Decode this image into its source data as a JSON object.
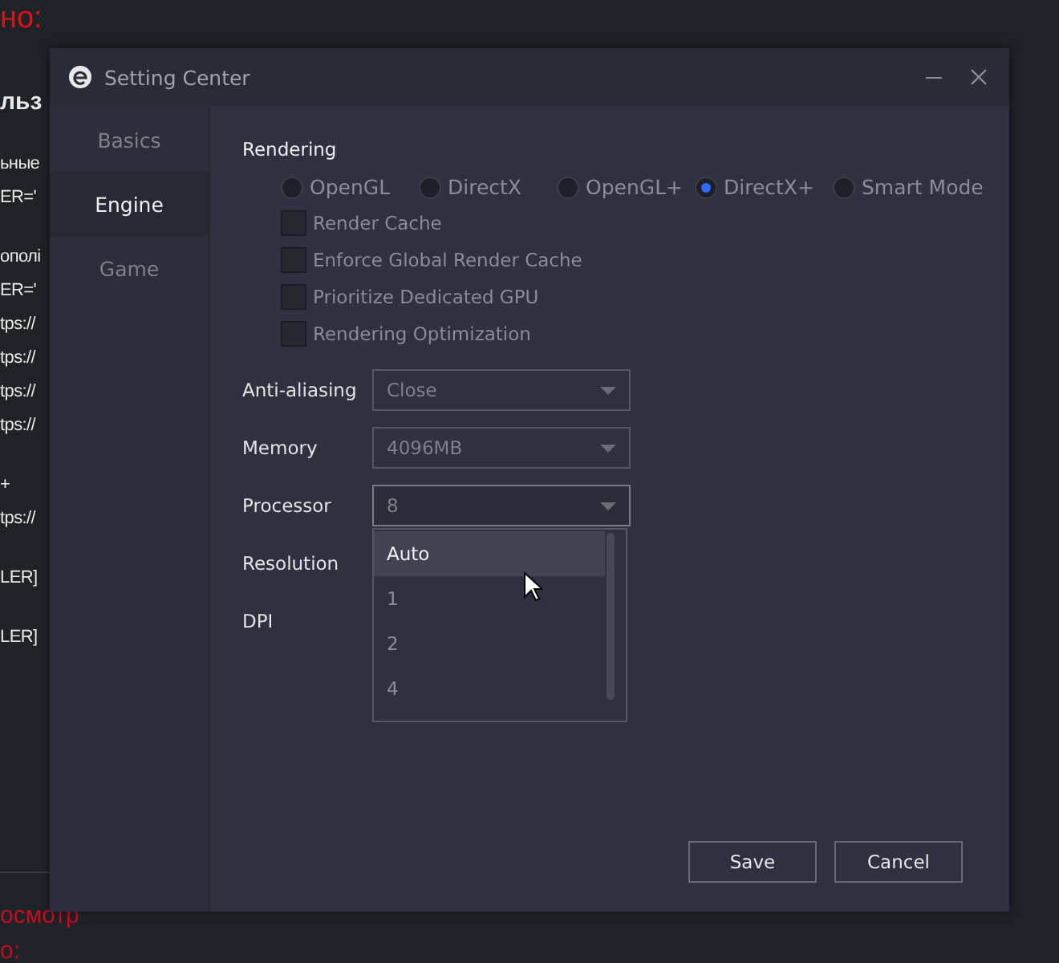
{
  "background_page": {
    "blocks": [
      {
        "kind": "alert",
        "lines": [
          "но:"
        ]
      },
      {
        "kind": "heading",
        "lines": [
          "льз"
        ]
      },
      {
        "kind": "text",
        "lines": [
          "ьные",
          "ER='"
        ]
      },
      {
        "kind": "text",
        "lines": [
          "ополі",
          "ER='",
          "tps://",
          "tps://",
          "tps://",
          "tps://"
        ]
      },
      {
        "kind": "text",
        "lines": [
          "+",
          "tps://"
        ]
      },
      {
        "kind": "text",
        "lines": [
          "LER]"
        ]
      },
      {
        "kind": "text",
        "lines": [
          "LER]"
        ]
      }
    ],
    "footer": {
      "kind": "alert",
      "lines": [
        "осмотр",
        "о:"
      ]
    }
  },
  "window": {
    "title": "Setting Center"
  },
  "sidebar": {
    "items": [
      {
        "label": "Basics",
        "selected": false
      },
      {
        "label": "Engine",
        "selected": true
      },
      {
        "label": "Game",
        "selected": false
      }
    ]
  },
  "rendering": {
    "label": "Rendering",
    "modes": [
      {
        "label": "OpenGL",
        "selected": false
      },
      {
        "label": "DirectX",
        "selected": false
      },
      {
        "label": "OpenGL+",
        "selected": false
      },
      {
        "label": "DirectX+",
        "selected": true
      },
      {
        "label": "Smart Mode",
        "selected": false
      }
    ],
    "options": [
      {
        "label": "Render Cache",
        "checked": false
      },
      {
        "label": "Enforce Global Render Cache",
        "checked": false
      },
      {
        "label": "Prioritize Dedicated GPU",
        "checked": false
      },
      {
        "label": "Rendering Optimization",
        "checked": false
      }
    ]
  },
  "fields": [
    {
      "label": "Anti-aliasing",
      "value": "Close",
      "expanded": false
    },
    {
      "label": "Memory",
      "value": "4096MB",
      "expanded": false
    },
    {
      "label": "Processor",
      "value": "8",
      "expanded": true,
      "options": [
        {
          "label": "Auto",
          "highlighted": true
        },
        {
          "label": "1",
          "highlighted": false
        },
        {
          "label": "2",
          "highlighted": false
        },
        {
          "label": "4",
          "highlighted": false
        }
      ]
    },
    {
      "label": "Resolution"
    },
    {
      "label": "DPI"
    }
  ],
  "buttons": [
    "Save",
    "Cancel"
  ]
}
